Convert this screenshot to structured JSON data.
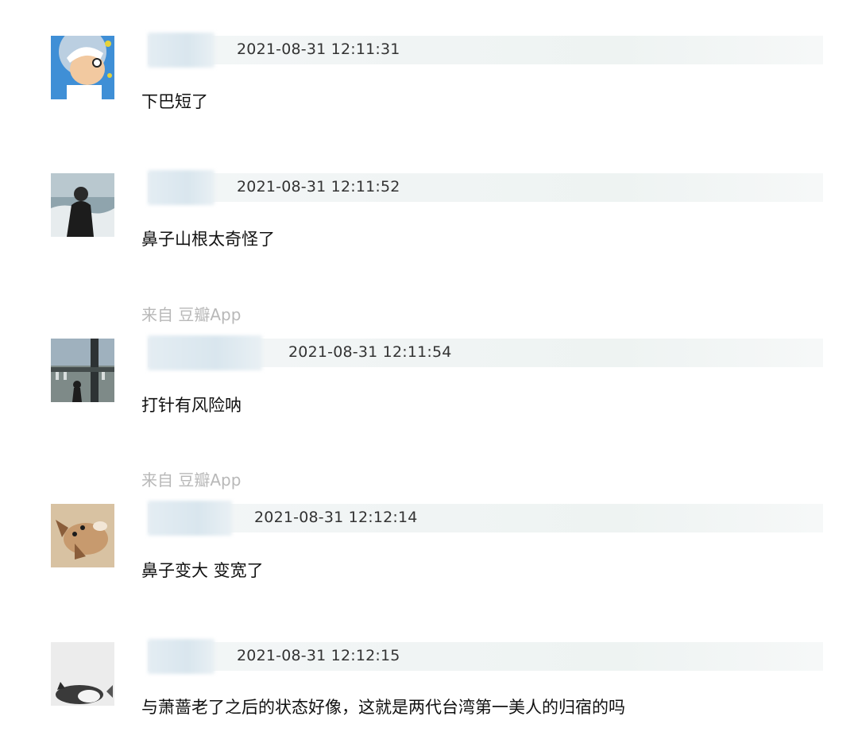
{
  "comments": [
    {
      "username": "",
      "timestamp": "2021-08-31 12:11:31",
      "text": "下巴短了",
      "avatar_icon": "cartoon-boy-avatar"
    },
    {
      "username": "",
      "timestamp": "2021-08-31 12:11:52",
      "text": "鼻子山根太奇怪了",
      "avatar_icon": "person-by-sea-avatar"
    },
    {
      "username": "",
      "source": "来自 豆瓣App",
      "timestamp": "2021-08-31 12:11:54",
      "text": "打针有风险呐",
      "avatar_icon": "street-scene-avatar"
    },
    {
      "username": "",
      "source": "来自 豆瓣App",
      "timestamp": "2021-08-31 12:12:14",
      "text": "鼻子变大 变宽了",
      "avatar_icon": "puppy-avatar"
    },
    {
      "username": "",
      "timestamp": "2021-08-31 12:12:15",
      "text": "与萧蔷老了之后的状态好像，这就是两代台湾第一美人的归宿的吗",
      "avatar_icon": "cat-avatar"
    }
  ]
}
